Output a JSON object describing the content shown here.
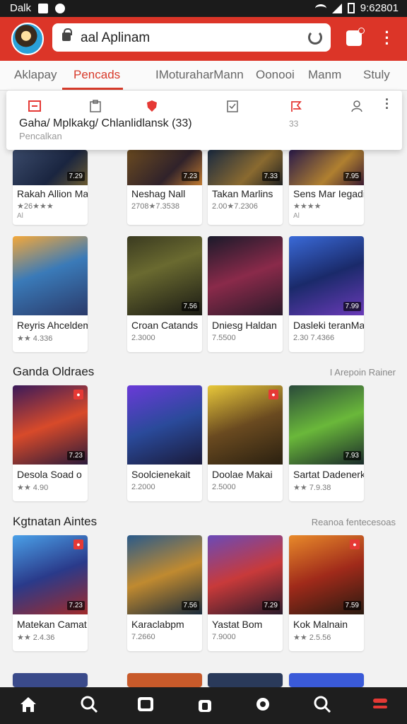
{
  "status": {
    "left_text": "Dalk",
    "right_text": "9:62801"
  },
  "browser": {
    "url": "aal Aplinam"
  },
  "categories": [
    {
      "label": "Aklapay"
    },
    {
      "label": "Pencads"
    },
    {
      "label": "IMoturaharMann"
    },
    {
      "label": "Oonooi"
    },
    {
      "label": "Manm"
    },
    {
      "label": "Stuly"
    }
  ],
  "dropdown": {
    "title": "Gaha/ Mplkakg/ Chlanlidlansk (33)",
    "subtitle": "Pencalkan",
    "count": "33"
  },
  "rows": [
    {
      "section": null,
      "cards": [
        {
          "title": "Rakah Allion Manai",
          "sub": "★26★★★",
          "sub2": "Al",
          "chip": "7.29"
        },
        {
          "title": "Neshag Nall",
          "sub": "2708★7.3538",
          "sub2": "",
          "chip": "7.23"
        },
        {
          "title": "Takan Marlins",
          "sub": "2.00★7.2306",
          "sub2": "",
          "chip": "7.33"
        },
        {
          "title": "Sens Mar Iegadi",
          "sub": "★★★★",
          "sub2": "Al",
          "chip": "7.95"
        }
      ]
    },
    {
      "section": null,
      "cards": [
        {
          "title": "Reyris Ahceldemaro",
          "sub": "★★ 4.336",
          "chip": ""
        },
        {
          "title": "Croan Catands",
          "sub": "2.3000",
          "chip": "7.56"
        },
        {
          "title": "Dniesg Haldan",
          "sub": "7.5500",
          "chip": ""
        },
        {
          "title": "Dasleki teranMan",
          "sub": "2.30 7.4366",
          "chip": "7.99"
        }
      ]
    },
    {
      "section": {
        "title": "Ganda Oldraes",
        "link": "I Arepoin Rainer"
      },
      "cards": [
        {
          "title": "Desola Soad o",
          "sub": "★★ 4.90",
          "chip": "7.23"
        },
        {
          "title": "Soolcienekait",
          "sub": "2.2000",
          "chip": ""
        },
        {
          "title": "Doolae Makai",
          "sub": "2.5000",
          "chip": ""
        },
        {
          "title": "Sartat Dadenerka",
          "sub": "★★ 7.9.38",
          "chip": "7.93"
        }
      ]
    },
    {
      "section": {
        "title": "Kgtnatan Aintes",
        "link": "Reanoa fentecesoas"
      },
      "cards": [
        {
          "title": "Matekan Camat",
          "sub": "★★ 2.4.36",
          "chip": "7.23"
        },
        {
          "title": "Karaclabpm",
          "sub": "7.2660",
          "chip": "7.56"
        },
        {
          "title": "Yastat Bom",
          "sub": "7.9000",
          "chip": "7.29"
        },
        {
          "title": "Kok Malnain",
          "sub": "★★ 2.5.56",
          "chip": "7.59"
        }
      ]
    }
  ]
}
